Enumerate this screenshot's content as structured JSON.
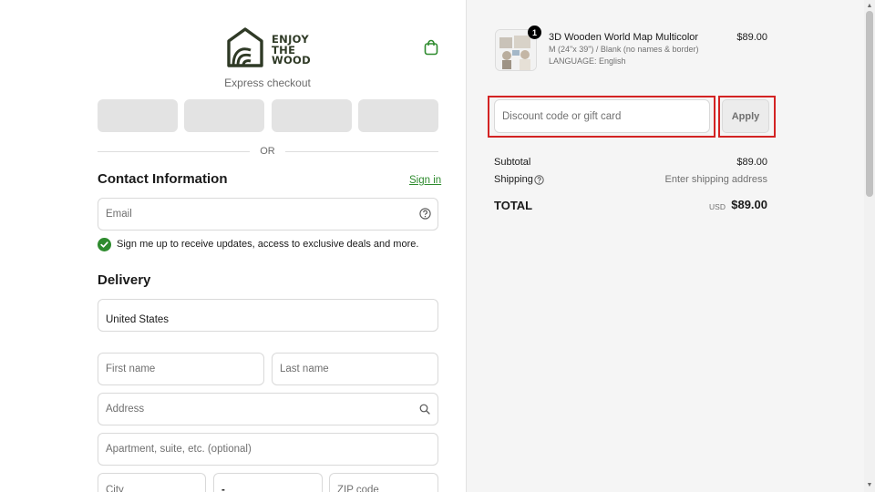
{
  "brand": {
    "logo_line1": "ENJOY",
    "logo_line2": "THE",
    "logo_line3": "WOOD",
    "primary_color": "#2f3a26",
    "accent_color": "#2e8b2e"
  },
  "header": {
    "cart_icon": "shopping-bag-icon"
  },
  "express": {
    "label": "Express checkout",
    "separator": "OR"
  },
  "contact": {
    "title": "Contact Information",
    "sign_in": "Sign in",
    "email_placeholder": "Email",
    "newsletter": "Sign me up to receive updates, access to exclusive deals and more."
  },
  "delivery": {
    "title": "Delivery",
    "country": "United States",
    "first_name_placeholder": "First name",
    "last_name_placeholder": "Last name",
    "address_placeholder": "Address",
    "apartment_placeholder": "Apartment, suite, etc. (optional)",
    "city_placeholder": "City",
    "state_value": "-",
    "zip_placeholder": "ZIP code"
  },
  "order": {
    "item": {
      "quantity": "1",
      "name": "3D Wooden World Map Multicolor",
      "variant": "M (24\"x 39\") / Blank (no names & border)",
      "language": "LANGUAGE: English",
      "price": "$89.00"
    },
    "discount_placeholder": "Discount code or gift card",
    "apply_label": "Apply",
    "highlight_color": "#d32323",
    "subtotal_label": "Subtotal",
    "subtotal_value": "$89.00",
    "shipping_label": "Shipping",
    "shipping_value": "Enter shipping address",
    "total_label": "TOTAL",
    "total_currency": "USD",
    "total_value": "$89.00"
  }
}
